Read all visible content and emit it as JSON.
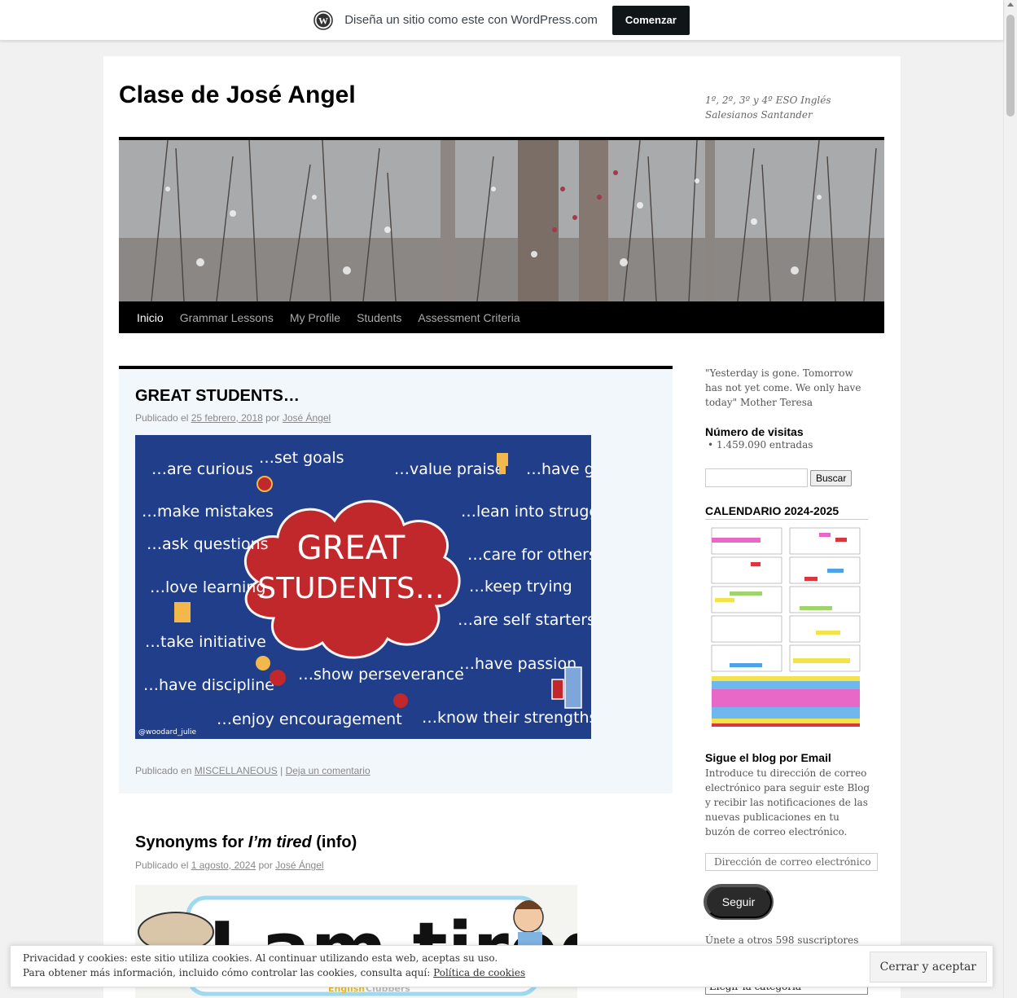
{
  "wpbar": {
    "text": "Diseña un sitio como este con WordPress.com",
    "button": "Comenzar"
  },
  "site": {
    "title": "Clase de José Angel",
    "description": "1º, 2º, 3º y 4º ESO Inglés Salesianos Santander"
  },
  "nav": {
    "items": [
      "Inicio",
      "Grammar Lessons",
      "My Profile",
      "Students",
      "Assessment Criteria"
    ]
  },
  "posts": [
    {
      "title": "GREAT STUDENTS…",
      "meta_prefix": "Publicado el",
      "date": "25 febrero, 2018",
      "by": "por",
      "author": "José Ángel",
      "image_words": {
        "center_line1": "GREAT",
        "center_line2": "STUDENTS…",
        "phrases": [
          "…are curious",
          "…set goals",
          "…value praise",
          "…have grit",
          "…make mistakes",
          "…lean into struggle",
          "…ask questions",
          "…care for others",
          "…love learning",
          "…keep trying",
          "…are self starters",
          "…take initiative",
          "…have passion",
          "…have discipline",
          "…show perseverance",
          "…enjoy encouragement",
          "…know their strengths",
          "@woodard_julie"
        ]
      },
      "footer_prefix": "Publicado en",
      "category": "MISCELLANEOUS",
      "separator": "|",
      "comment_link": "Deja un comentario"
    },
    {
      "title_plain": "Synonyms for ",
      "title_em": "I’m tired",
      "title_suffix": " (info)",
      "meta_prefix": "Publicado el",
      "date": "1 agosto, 2024",
      "by": "por",
      "author": "José Ángel",
      "image_words": {
        "big": "I am tired",
        "small_yellow": "English",
        "small_grey": "Clubbers"
      }
    }
  ],
  "sidebar": {
    "quote": "\"Yesterday is gone. Tomorrow has not yet come. We only have today\" Mother Teresa",
    "visits_title": "Número de visitas",
    "visits_value": "1.459.090 entradas",
    "search_button": "Buscar",
    "calendar_title": "CALENDARIO 2024-2025",
    "follow_title": "Sigue el blog por Email",
    "follow_text": "Introduce tu dirección de correo electrónico para seguir este Blog y recibir las notificaciones de las nuevas publicaciones en tu buzón de correo electrónico.",
    "email_placeholder": "Dirección de correo electrónico",
    "follow_button": "Seguir",
    "subscribers": "Únete a otros 598 suscriptores",
    "category_select": "Elegir la categoría"
  },
  "cookie": {
    "line1": "Privacidad y cookies: este sitio utiliza cookies. Al continuar utilizando esta web, aceptas su uso.",
    "line2_prefix": "Para obtener más información, incluido cómo controlar las cookies, consulta aquí:",
    "link": "Política de cookies",
    "button": "Cerrar y aceptar"
  },
  "colors": {
    "great_bg": "#213e8a",
    "cloud_red": "#c0282c",
    "post_bg": "#f2f7fc"
  }
}
